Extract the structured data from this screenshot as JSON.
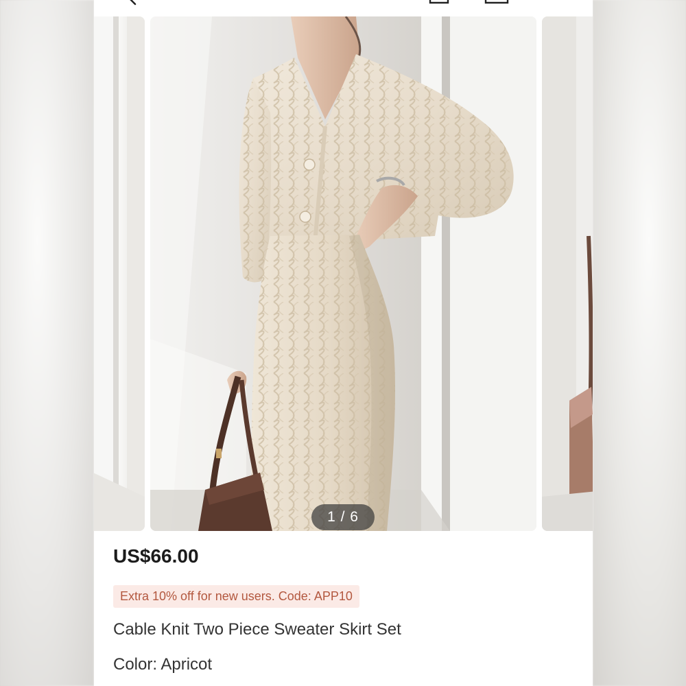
{
  "header": {
    "back_icon": "chevron-left-icon",
    "right_icons": [
      "bag-icon",
      "share-icon"
    ]
  },
  "gallery": {
    "current_page": 1,
    "total_pages": 6,
    "pager_label": "1 / 6"
  },
  "product": {
    "price": "US$66.00",
    "promo": "Extra 10% off for new users. Code: APP10",
    "title": "Cable Knit Two Piece Sweater Skirt Set",
    "color_label": "Color: Apricot"
  },
  "colors": {
    "promo_bg": "#fbeae6",
    "promo_text": "#b3583f",
    "price_text": "#1c1c1c",
    "body_text": "#333333"
  }
}
